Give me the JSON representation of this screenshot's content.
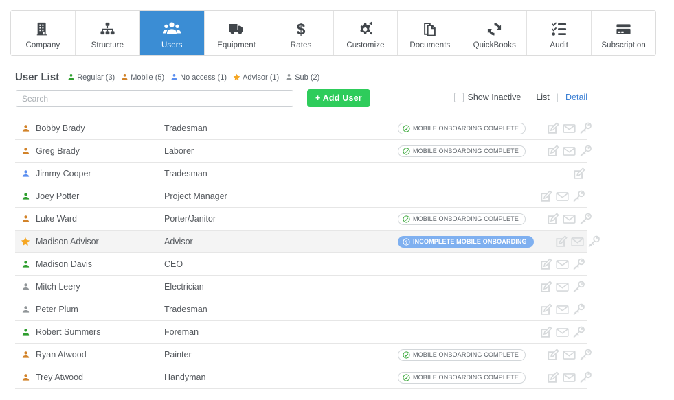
{
  "nav": {
    "tabs": [
      {
        "label": "Company",
        "icon": "building-icon",
        "active": false
      },
      {
        "label": "Structure",
        "icon": "org-chart-icon",
        "active": false
      },
      {
        "label": "Users",
        "icon": "users-icon",
        "active": true
      },
      {
        "label": "Equipment",
        "icon": "truck-icon",
        "active": false
      },
      {
        "label": "Rates",
        "icon": "dollar-icon",
        "active": false
      },
      {
        "label": "Customize",
        "icon": "gears-icon",
        "active": false
      },
      {
        "label": "Documents",
        "icon": "documents-icon",
        "active": false
      },
      {
        "label": "QuickBooks",
        "icon": "sync-icon",
        "active": false
      },
      {
        "label": "Audit",
        "icon": "checklist-icon",
        "active": false
      },
      {
        "label": "Subscription",
        "icon": "credit-card-icon",
        "active": false
      }
    ]
  },
  "header": {
    "title": "User List",
    "legend": [
      {
        "label": "Regular (3)",
        "icon": "person-icon",
        "color": "#2f9e2f"
      },
      {
        "label": "Mobile (5)",
        "icon": "person-icon",
        "color": "#d2832a"
      },
      {
        "label": "No access (1)",
        "icon": "person-icon",
        "color": "#5b8ff0"
      },
      {
        "label": "Advisor (1)",
        "icon": "star-icon",
        "color": "#f5a623"
      },
      {
        "label": "Sub (2)",
        "icon": "person-icon",
        "color": "#919699"
      }
    ]
  },
  "toolbar": {
    "search_placeholder": "Search",
    "search_value": "",
    "add_user_label": "+ Add User",
    "show_inactive_label": "Show Inactive",
    "show_inactive_checked": false,
    "view_list_label": "List",
    "view_separator": "|",
    "view_detail_label": "Detail",
    "add_button_color": "#2ecc5b"
  },
  "status_labels": {
    "complete": "MOBILE ONBOARDING COMPLETE",
    "incomplete": "INCOMPLETE MOBILE ONBOARDING"
  },
  "actions": {
    "edit": "edit-icon",
    "mail": "envelope-icon",
    "key": "key-icon"
  },
  "rows": [
    {
      "name": "Bobby Brady",
      "role": "Tradesman",
      "icon": "person-icon",
      "color": "#d2832a",
      "status": "complete",
      "highlight": false,
      "actions": [
        "edit",
        "mail",
        "key"
      ]
    },
    {
      "name": "Greg Brady",
      "role": "Laborer",
      "icon": "person-icon",
      "color": "#d2832a",
      "status": "complete",
      "highlight": false,
      "actions": [
        "edit",
        "mail",
        "key"
      ]
    },
    {
      "name": "Jimmy Cooper",
      "role": "Tradesman",
      "icon": "person-icon",
      "color": "#5b8ff0",
      "status": "none",
      "highlight": false,
      "actions": [
        "edit"
      ]
    },
    {
      "name": "Joey Potter",
      "role": "Project Manager",
      "icon": "person-icon",
      "color": "#2f9e2f",
      "status": "none",
      "highlight": false,
      "actions": [
        "edit",
        "mail",
        "key"
      ]
    },
    {
      "name": "Luke Ward",
      "role": "Porter/Janitor",
      "icon": "person-icon",
      "color": "#d2832a",
      "status": "complete",
      "highlight": false,
      "actions": [
        "edit",
        "mail",
        "key"
      ]
    },
    {
      "name": "Madison Advisor",
      "role": "Advisor",
      "icon": "star-icon",
      "color": "#f5a623",
      "status": "incomplete",
      "highlight": true,
      "actions": [
        "edit",
        "mail",
        "key"
      ]
    },
    {
      "name": "Madison Davis",
      "role": "CEO",
      "icon": "person-icon",
      "color": "#2f9e2f",
      "status": "none",
      "highlight": false,
      "actions": [
        "edit",
        "mail",
        "key"
      ]
    },
    {
      "name": "Mitch Leery",
      "role": "Electrician",
      "icon": "person-icon",
      "color": "#919699",
      "status": "none",
      "highlight": false,
      "actions": [
        "edit",
        "mail",
        "key"
      ]
    },
    {
      "name": "Peter Plum",
      "role": "Tradesman",
      "icon": "person-icon",
      "color": "#919699",
      "status": "none",
      "highlight": false,
      "actions": [
        "edit",
        "mail",
        "key"
      ]
    },
    {
      "name": "Robert Summers",
      "role": "Foreman",
      "icon": "person-icon",
      "color": "#2f9e2f",
      "status": "none",
      "highlight": false,
      "actions": [
        "edit",
        "mail",
        "key"
      ]
    },
    {
      "name": "Ryan Atwood",
      "role": "Painter",
      "icon": "person-icon",
      "color": "#d2832a",
      "status": "complete",
      "highlight": false,
      "actions": [
        "edit",
        "mail",
        "key"
      ]
    },
    {
      "name": "Trey Atwood",
      "role": "Handyman",
      "icon": "person-icon",
      "color": "#d2832a",
      "status": "complete",
      "highlight": false,
      "actions": [
        "edit",
        "mail",
        "key"
      ]
    }
  ]
}
